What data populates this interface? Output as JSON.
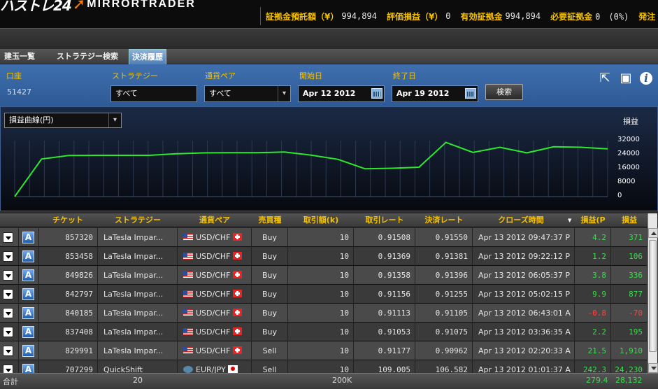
{
  "header": {
    "brand_left": "ハストレ24",
    "brand_right": "MIRRORTRADER",
    "account": [
      {
        "label": "証拠金預託額（¥）",
        "value": "994,894"
      },
      {
        "label": "評価損益（¥）",
        "value": "0"
      },
      {
        "label": "有効証拠金",
        "value": "994,894"
      },
      {
        "label": "必要証拠金",
        "value": "0　(0%)"
      },
      {
        "label": "発注",
        "value": ""
      }
    ]
  },
  "tabs": [
    {
      "label": "建玉一覧",
      "active": false
    },
    {
      "label": "ストラテジー検索",
      "active": false
    },
    {
      "label": "決済履歴",
      "active": true
    }
  ],
  "filter": {
    "account_label": "口座",
    "account_value": "51427",
    "strategy_label": "ストラテジー",
    "strategy_value": "すべて",
    "pair_label": "通貨ペア",
    "pair_value": "すべて",
    "start_label": "開始日",
    "start_value": "Apr 12 2012",
    "end_label": "終了日",
    "end_value": "Apr 19 2012",
    "search_label": "検索",
    "export_icon": "export-icon",
    "save_icon": "save-icon",
    "info_icon": "info-icon"
  },
  "chart_data": {
    "type": "line",
    "selector": "損益曲線(円)",
    "ylabel": "損益",
    "ylim": [
      0,
      32000
    ],
    "y_ticks": [
      "32000",
      "24000",
      "16000",
      "8000",
      "0"
    ],
    "color": "#2ee82e",
    "series": [
      {
        "values": [
          0,
          21500,
          23500,
          23600,
          23600,
          23600,
          24500,
          25000,
          25100,
          25100,
          25500,
          23700,
          21300,
          15900,
          16200,
          16800,
          31000,
          25300,
          28200,
          25000,
          28500,
          28200,
          27300
        ]
      }
    ]
  },
  "table": {
    "columns": [
      "",
      "",
      "チケット",
      "ストラテジー",
      "通貨ペア",
      "売買種",
      "取引額(k)",
      "取引レート",
      "決済レート",
      "クローズ時間",
      "損益(P",
      "損益"
    ],
    "rows": [
      {
        "ticket": "857320",
        "strategy": "LaTesla Impar...",
        "pair": "USD/CHF",
        "side": "Buy",
        "amount": "10",
        "open": "0.91508",
        "close": "0.91550",
        "time": "Apr 13 2012 09:47:37 P",
        "pips": "4.2",
        "pl": "371",
        "sign": "pos",
        "flag1": "us",
        "flag2": "ch"
      },
      {
        "ticket": "853458",
        "strategy": "LaTesla Impar...",
        "pair": "USD/CHF",
        "side": "Buy",
        "amount": "10",
        "open": "0.91369",
        "close": "0.91381",
        "time": "Apr 13 2012 09:22:12 P",
        "pips": "1.2",
        "pl": "106",
        "sign": "pos",
        "flag1": "us",
        "flag2": "ch"
      },
      {
        "ticket": "849826",
        "strategy": "LaTesla Impar...",
        "pair": "USD/CHF",
        "side": "Buy",
        "amount": "10",
        "open": "0.91358",
        "close": "0.91396",
        "time": "Apr 13 2012 06:05:37 P",
        "pips": "3.8",
        "pl": "336",
        "sign": "pos",
        "flag1": "us",
        "flag2": "ch"
      },
      {
        "ticket": "842797",
        "strategy": "LaTesla Impar...",
        "pair": "USD/CHF",
        "side": "Buy",
        "amount": "10",
        "open": "0.91156",
        "close": "0.91255",
        "time": "Apr 13 2012 05:02:15 P",
        "pips": "9.9",
        "pl": "877",
        "sign": "pos",
        "flag1": "us",
        "flag2": "ch"
      },
      {
        "ticket": "840185",
        "strategy": "LaTesla Impar...",
        "pair": "USD/CHF",
        "side": "Buy",
        "amount": "10",
        "open": "0.91113",
        "close": "0.91105",
        "time": "Apr 13 2012 06:43:01 A",
        "pips": "-0.8",
        "pl": "-70",
        "sign": "neg",
        "flag1": "us",
        "flag2": "ch"
      },
      {
        "ticket": "837408",
        "strategy": "LaTesla Impar...",
        "pair": "USD/CHF",
        "side": "Buy",
        "amount": "10",
        "open": "0.91053",
        "close": "0.91075",
        "time": "Apr 13 2012 03:36:35 A",
        "pips": "2.2",
        "pl": "195",
        "sign": "pos",
        "flag1": "us",
        "flag2": "ch"
      },
      {
        "ticket": "829991",
        "strategy": "LaTesla Impar...",
        "pair": "USD/CHF",
        "side": "Sell",
        "amount": "10",
        "open": "0.91177",
        "close": "0.90962",
        "time": "Apr 13 2012 02:20:33 A",
        "pips": "21.5",
        "pl": "1,910",
        "sign": "pos",
        "flag1": "us",
        "flag2": "ch"
      },
      {
        "ticket": "707299",
        "strategy": "QuickShift",
        "pair": "EUR/JPY",
        "side": "Sell",
        "amount": "10",
        "open": "109.005",
        "close": "106.582",
        "time": "Apr 13 2012 01:01:37 A",
        "pips": "242.3",
        "pl": "24,230",
        "sign": "pos",
        "flag1": "eu",
        "flag2": "jp"
      }
    ]
  },
  "footer": {
    "label": "合計",
    "count": "20",
    "amount": "200K",
    "pips": "279.4",
    "pl": "28,132"
  }
}
